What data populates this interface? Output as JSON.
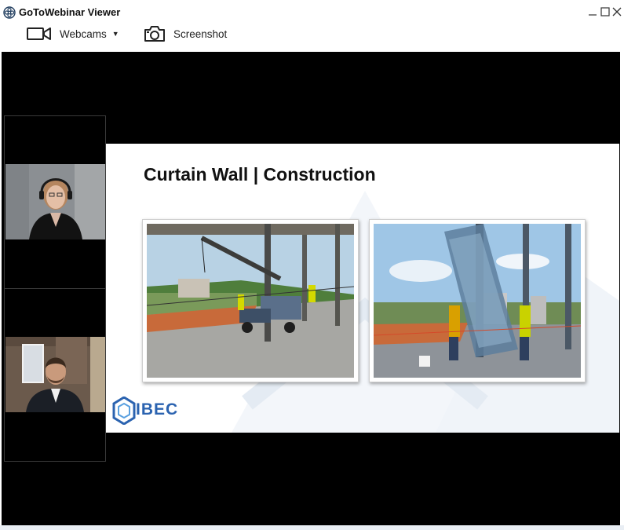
{
  "window": {
    "title": "GoToWebinar Viewer",
    "icon": "gotowebinar-flower-icon"
  },
  "toolbar": {
    "webcams_label": "Webcams",
    "screenshot_label": "Screenshot"
  },
  "webcams": [
    {
      "icon": "presenter-webcam-feed"
    },
    {
      "icon": "presenter-webcam-feed"
    }
  ],
  "slide": {
    "title": "Curtain Wall | Construction",
    "logo_text": "IBEC",
    "photos": [
      "crane-install-photo",
      "glass-panel-install-photo"
    ]
  },
  "colors": {
    "stage": "#000000",
    "logo": "#2b63b0"
  }
}
